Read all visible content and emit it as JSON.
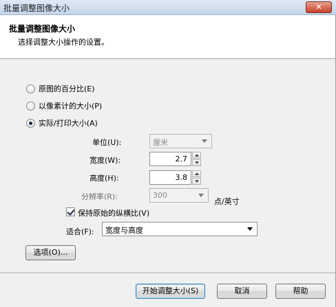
{
  "window": {
    "title": "批量调整图像大小",
    "close_glyph": "✕"
  },
  "header": {
    "title": "批量调整图像大小",
    "subtitle": "选择调整大小操作的设置。"
  },
  "options": {
    "percent_label": "原图的百分比(E)",
    "pixel_label": "以像素计的大小(P)",
    "print_label": "实际/打印大小(A)",
    "selected": "print"
  },
  "fields": {
    "unit_label": "单位(U):",
    "unit_value": "厘米",
    "width_label": "宽度(W):",
    "width_value": "2.7",
    "height_label": "高度(H):",
    "height_value": "3.8",
    "resolution_label": "分辨率(R):",
    "resolution_value": "300",
    "resolution_unit": "点/英寸",
    "keep_ratio_label": "保持原始的纵横比(V)",
    "keep_ratio_checked": true,
    "fit_label": "适合(F):",
    "fit_value": "宽度与高度"
  },
  "buttons": {
    "options": "选项(O)...",
    "start": "开始调整大小(S)",
    "cancel": "取消",
    "help": "帮助"
  }
}
